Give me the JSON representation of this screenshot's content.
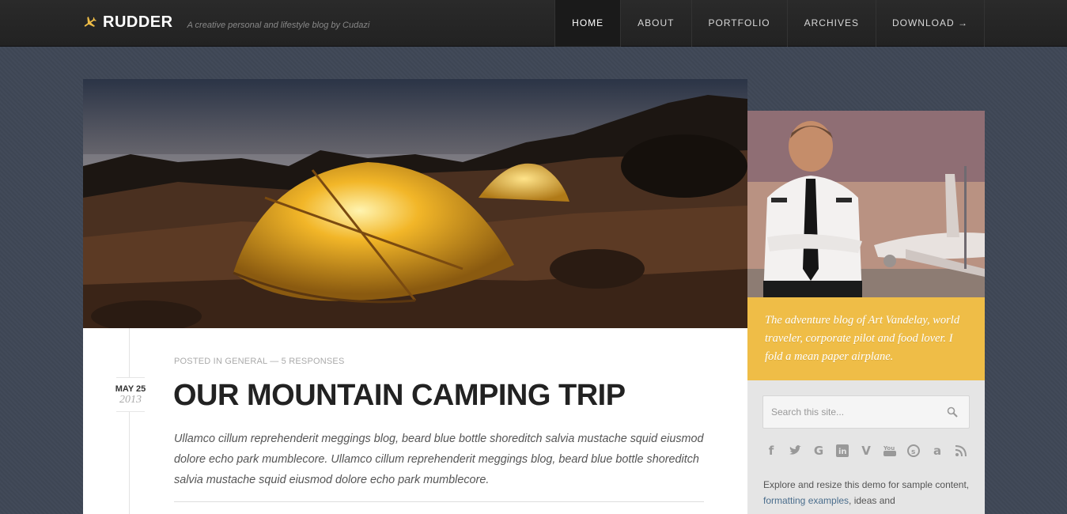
{
  "header": {
    "brand": "RUDDER",
    "tagline": "A creative personal and lifestyle blog by Cudazi",
    "nav": [
      {
        "label": "HOME",
        "active": true
      },
      {
        "label": "ABOUT",
        "active": false
      },
      {
        "label": "PORTFOLIO",
        "active": false
      },
      {
        "label": "ARCHIVES",
        "active": false
      },
      {
        "label": "DOWNLOAD →",
        "active": false
      }
    ]
  },
  "post": {
    "meta_prefix": "POSTED IN",
    "category": "GENERAL",
    "separator": "—",
    "responses": "5 RESPONSES",
    "date_md": "MAY 25",
    "date_year": "2013",
    "title": "OUR MOUNTAIN CAMPING TRIP",
    "excerpt": "Ullamco cillum reprehenderit meggings blog, beard blue bottle shoreditch salvia mustache squid eiusmod dolore echo park mumblecore. Ullamco cillum reprehenderit meggings blog, beard blue bottle shoreditch salvia mustache squid eiusmod dolore echo park mumblecore."
  },
  "sidebar": {
    "bio": "The adventure blog of Art Vandelay, world traveler, corporate pilot and food lover. I fold a mean paper airplane.",
    "search_placeholder": "Search this site...",
    "social_icons": [
      "facebook-icon",
      "twitter-icon",
      "google-icon",
      "linkedin-icon",
      "vimeo-icon",
      "youtube-icon",
      "skype-icon",
      "amazon-icon",
      "rss-icon"
    ],
    "about_text_1": "Explore and resize this demo for sample content,",
    "about_link": "formatting examples",
    "about_text_2": ", ideas and"
  },
  "colors": {
    "accent": "#efbd47",
    "header_bg": "#222222",
    "page_bg": "#3f4756"
  }
}
